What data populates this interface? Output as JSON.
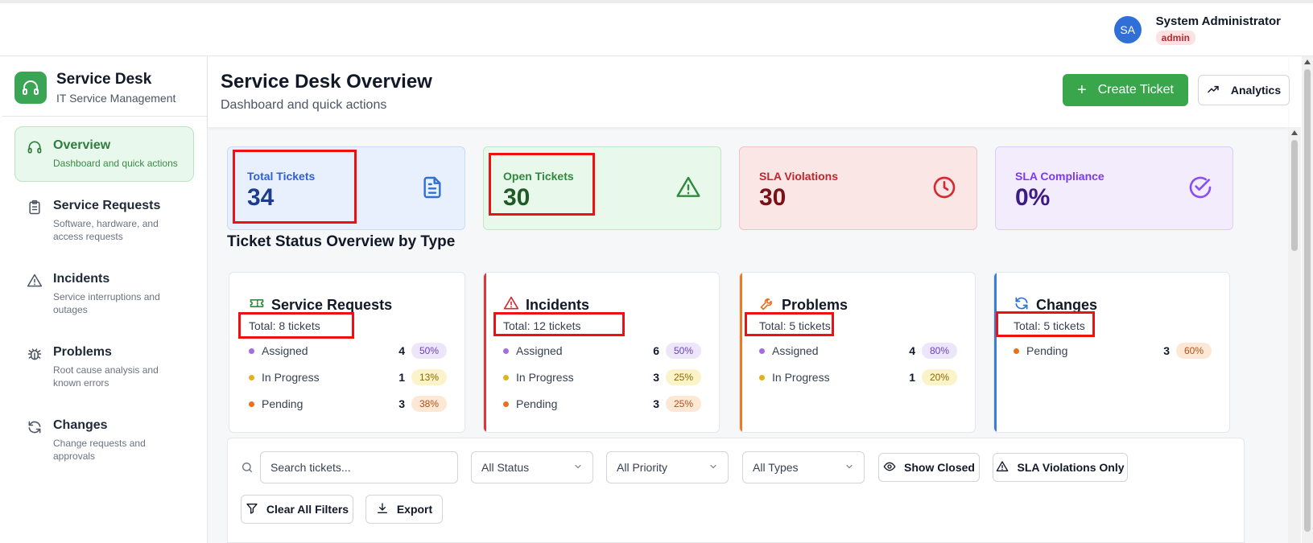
{
  "header": {
    "user_initials": "SA",
    "user_name": "System Administrator",
    "user_role": "admin"
  },
  "sidebar": {
    "brand_title": "Service Desk",
    "brand_subtitle": "IT Service Management",
    "items": [
      {
        "icon": "headset-icon",
        "label": "Overview",
        "desc": "Dashboard and quick actions",
        "active": true
      },
      {
        "icon": "clipboard-icon",
        "label": "Service Requests",
        "desc": "Software, hardware, and access requests",
        "active": false
      },
      {
        "icon": "warning-icon",
        "label": "Incidents",
        "desc": "Service interruptions and outages",
        "active": false
      },
      {
        "icon": "bug-icon",
        "label": "Problems",
        "desc": "Root cause analysis and known errors",
        "active": false
      },
      {
        "icon": "refresh-icon",
        "label": "Changes",
        "desc": "Change requests and approvals",
        "active": false
      }
    ]
  },
  "main": {
    "title": "Service Desk Overview",
    "subtitle": "Dashboard and quick actions",
    "create_label": "Create Ticket",
    "analytics_label": "Analytics"
  },
  "stats": [
    {
      "label": "Total Tickets",
      "value": "34",
      "icon": "document-icon",
      "color": "#2f5fd0"
    },
    {
      "label": "Open Tickets",
      "value": "30",
      "icon": "warning-icon",
      "color": "#2f8a3e"
    },
    {
      "label": "SLA Violations",
      "value": "30",
      "icon": "clock-icon",
      "color": "#c0262d"
    },
    {
      "label": "SLA Compliance",
      "value": "0%",
      "icon": "check-circle-icon",
      "color": "#7c3aed"
    }
  ],
  "section_title": "Ticket Status Overview by Type",
  "types": [
    {
      "title": "Service Requests",
      "icon": "ticket-icon",
      "total": "Total: 8 tickets",
      "rows": [
        {
          "label": "Assigned",
          "count": "4",
          "pct": "50%"
        },
        {
          "label": "In Progress",
          "count": "1",
          "pct": "13%"
        },
        {
          "label": "Pending",
          "count": "3",
          "pct": "38%"
        }
      ]
    },
    {
      "title": "Incidents",
      "icon": "warning-icon",
      "total": "Total: 12 tickets",
      "rows": [
        {
          "label": "Assigned",
          "count": "6",
          "pct": "50%"
        },
        {
          "label": "In Progress",
          "count": "3",
          "pct": "25%"
        },
        {
          "label": "Pending",
          "count": "3",
          "pct": "25%"
        }
      ]
    },
    {
      "title": "Problems",
      "icon": "wrench-icon",
      "total": "Total: 5 tickets",
      "rows": [
        {
          "label": "Assigned",
          "count": "4",
          "pct": "80%"
        },
        {
          "label": "In Progress",
          "count": "1",
          "pct": "20%"
        }
      ]
    },
    {
      "title": "Changes",
      "icon": "refresh-icon",
      "total": "Total: 5 tickets",
      "rows": [
        {
          "label": "Pending",
          "count": "3",
          "pct": "60%"
        }
      ]
    }
  ],
  "filters": {
    "search_placeholder": "Search tickets...",
    "status": "All Status",
    "priority": "All Priority",
    "types": "All Types",
    "show_closed": "Show Closed",
    "sla_only": "SLA Violations Only",
    "clear": "Clear All Filters",
    "export": "Export"
  },
  "colors": {
    "brand": "#3aa655",
    "assigned": "#a26be8",
    "in_progress": "#e2b21a",
    "pending": "#e8711f",
    "highlight": "#ee1111"
  }
}
